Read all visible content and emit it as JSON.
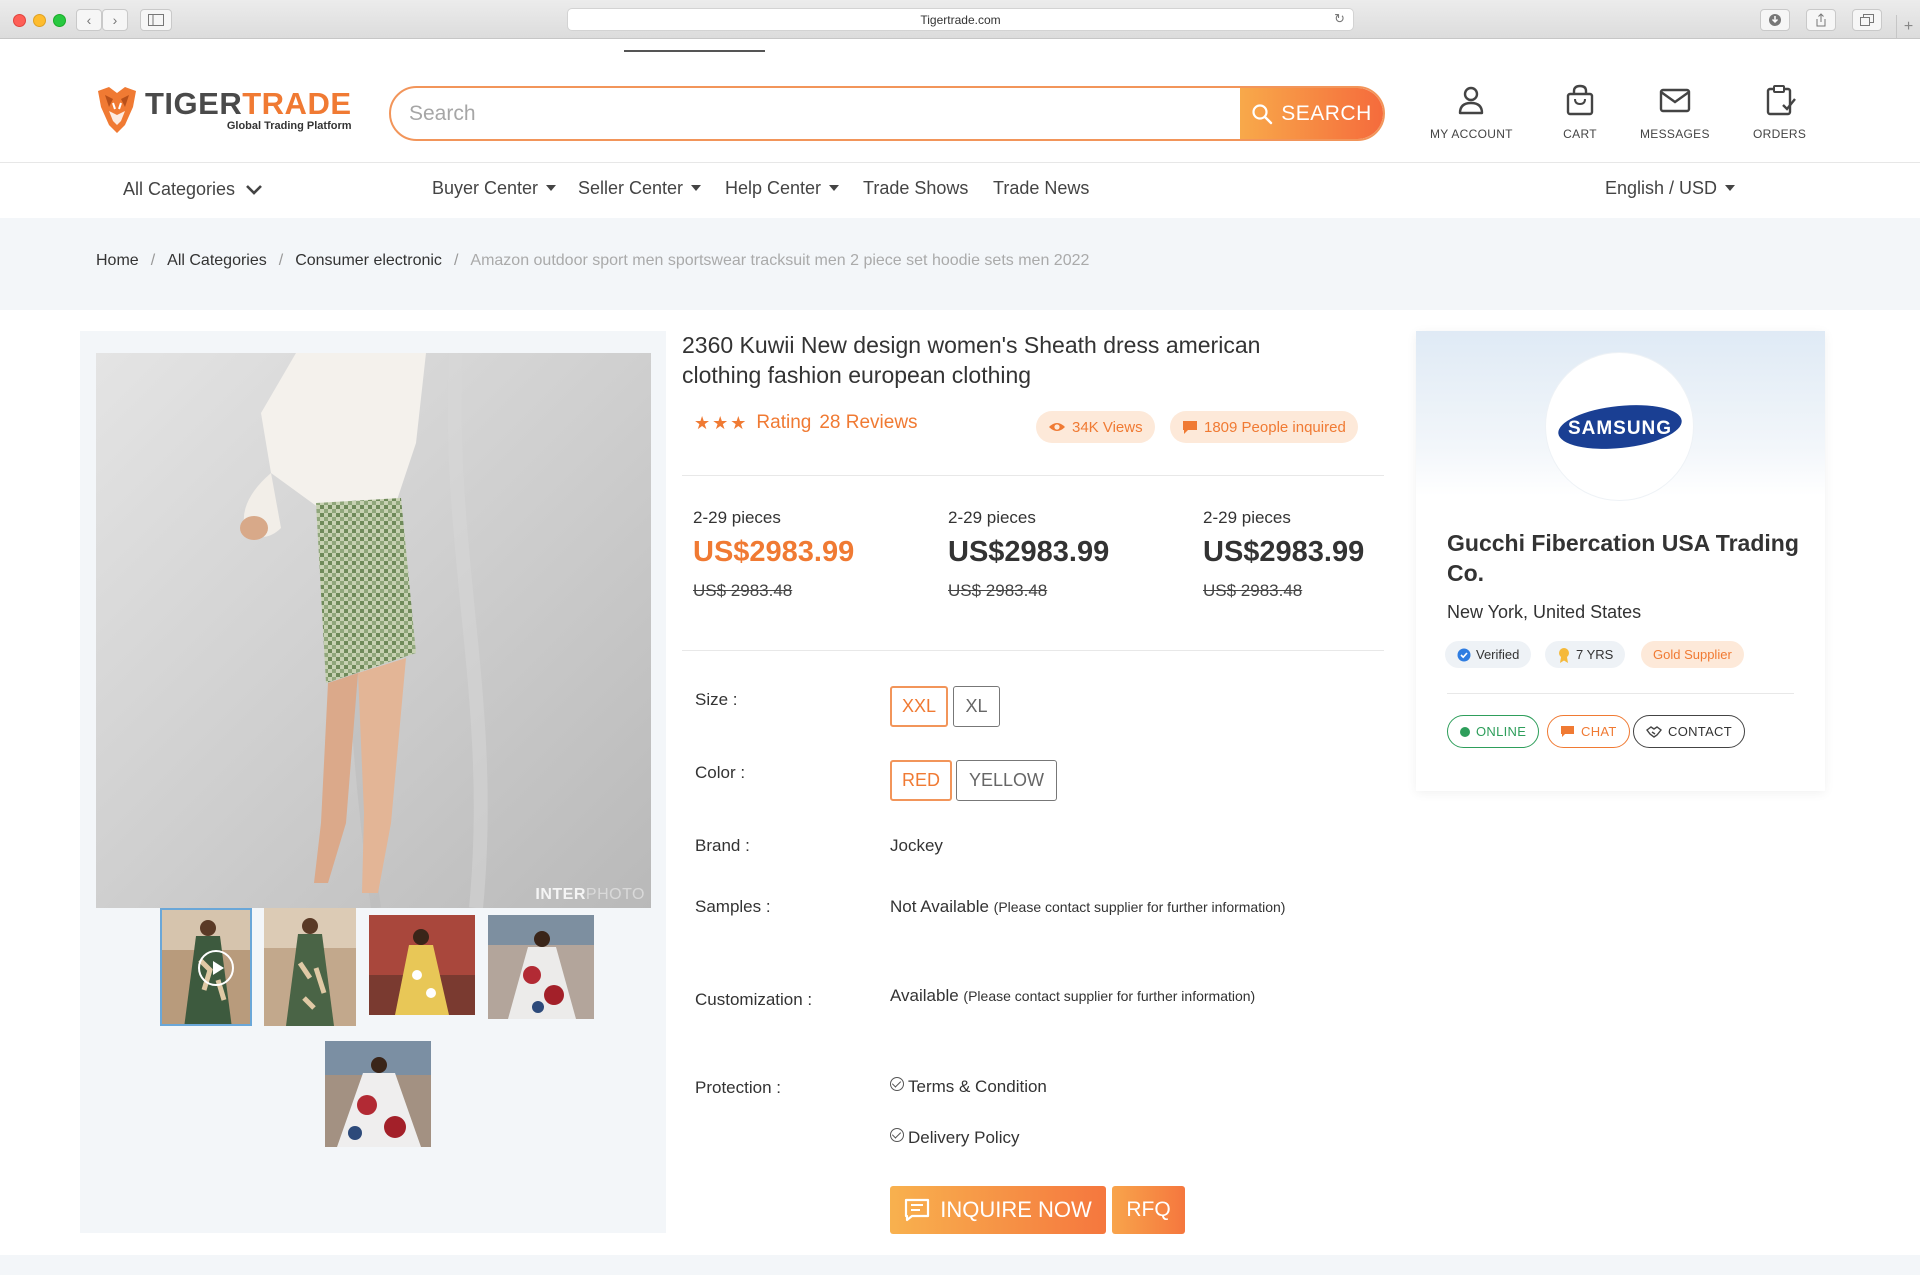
{
  "browser": {
    "url": "Tigertrade.com"
  },
  "header": {
    "logo_main": "TIGER",
    "logo_accent": "TRADE",
    "logo_tagline": "Global Trading Platform",
    "search_placeholder": "Search",
    "search_button": "SEARCH",
    "account": "MY ACCOUNT",
    "cart": "CART",
    "messages": "MESSAGES",
    "orders": "ORDERS"
  },
  "nav": {
    "all_categories": "All Categories",
    "buyer_center": "Buyer Center",
    "seller_center": "Seller Center",
    "help_center": "Help Center",
    "trade_shows": "Trade Shows",
    "trade_news": "Trade News",
    "language": "English / USD"
  },
  "breadcrumb": {
    "items": [
      "Home",
      "All Categories",
      "Consumer electronic"
    ],
    "current": "Amazon outdoor sport men sportswear tracksuit men 2 piece set hoodie sets men 2022"
  },
  "gallery": {
    "watermark_bold": "INTER",
    "watermark_light": "PHOTO"
  },
  "product": {
    "title": "2360 Kuwii New design women's Sheath dress american clothing fashion european clothing",
    "stars": "★★★",
    "rating_label": "Rating",
    "reviews": "28 Reviews",
    "views": "34K Views",
    "inquired": "1809 People inquired",
    "tiers": [
      {
        "qty": "2-29 pieces",
        "price": "US$2983.99",
        "old": "US$ 2983.48"
      },
      {
        "qty": "2-29 pieces",
        "price": "US$2983.99",
        "old": "US$ 2983.48"
      },
      {
        "qty": "2-29 pieces",
        "price": "US$2983.99",
        "old": "US$ 2983.48"
      }
    ],
    "size_label": "Size :",
    "sizes": [
      "XXL",
      "XL"
    ],
    "color_label": "Color :",
    "colors": [
      "RED",
      "YELLOW"
    ],
    "brand_label": "Brand :",
    "brand": "Jockey",
    "samples_label": "Samples :",
    "samples_value": "Not Available",
    "samples_note": "(Please contact supplier for further information)",
    "custom_label": "Customization :",
    "custom_value": "Available",
    "custom_note": "(Please contact supplier for further information)",
    "protection_label": "Protection :",
    "protection_items": [
      "Terms & Condition",
      "Delivery Policy"
    ],
    "inquire_button": "INQUIRE NOW",
    "rfq_button": "RFQ"
  },
  "supplier": {
    "logo_text": "SAMSUNG",
    "name": "Gucchi Fibercation USA Trading Co.",
    "location": "New York, United States",
    "verified": "Verified",
    "years": "7 YRS",
    "gold": "Gold Supplier",
    "online": "ONLINE",
    "chat": "CHAT",
    "contact": "CONTACT"
  },
  "colors": {
    "accent": "#f07a33",
    "accent_light": "#fde9d9",
    "online_green": "#2e9e5b",
    "verified_blue": "#2f7de1"
  }
}
